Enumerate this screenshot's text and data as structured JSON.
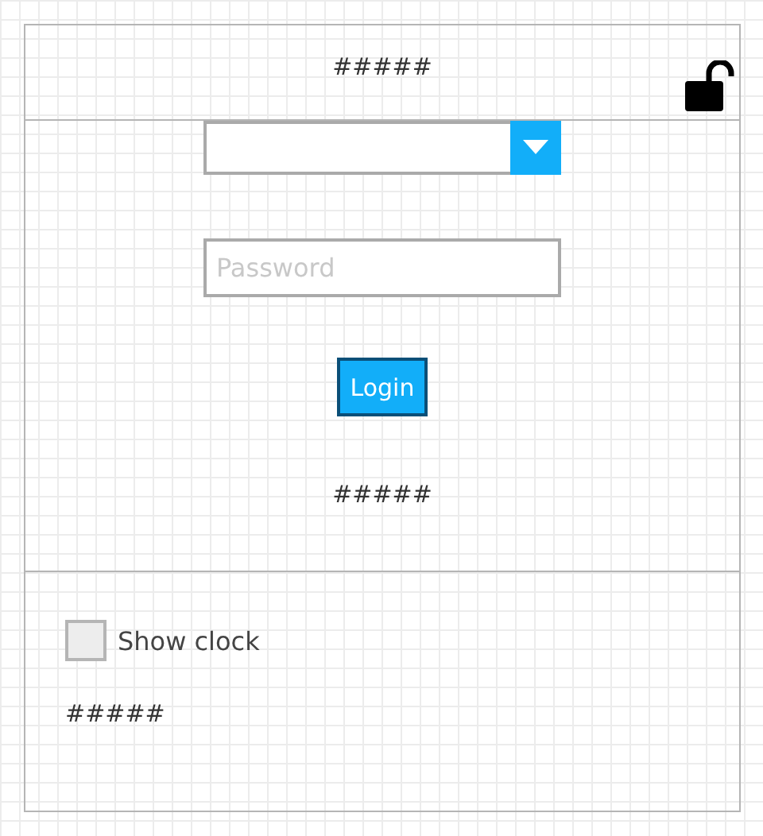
{
  "header": {
    "title": "#####",
    "locked": false
  },
  "login": {
    "password": {
      "placeholder": "Password"
    },
    "button": "Login",
    "message": "#####"
  },
  "options": {
    "show_clock": {
      "label": "Show clock",
      "checked": false
    },
    "footer_text": "#####"
  }
}
